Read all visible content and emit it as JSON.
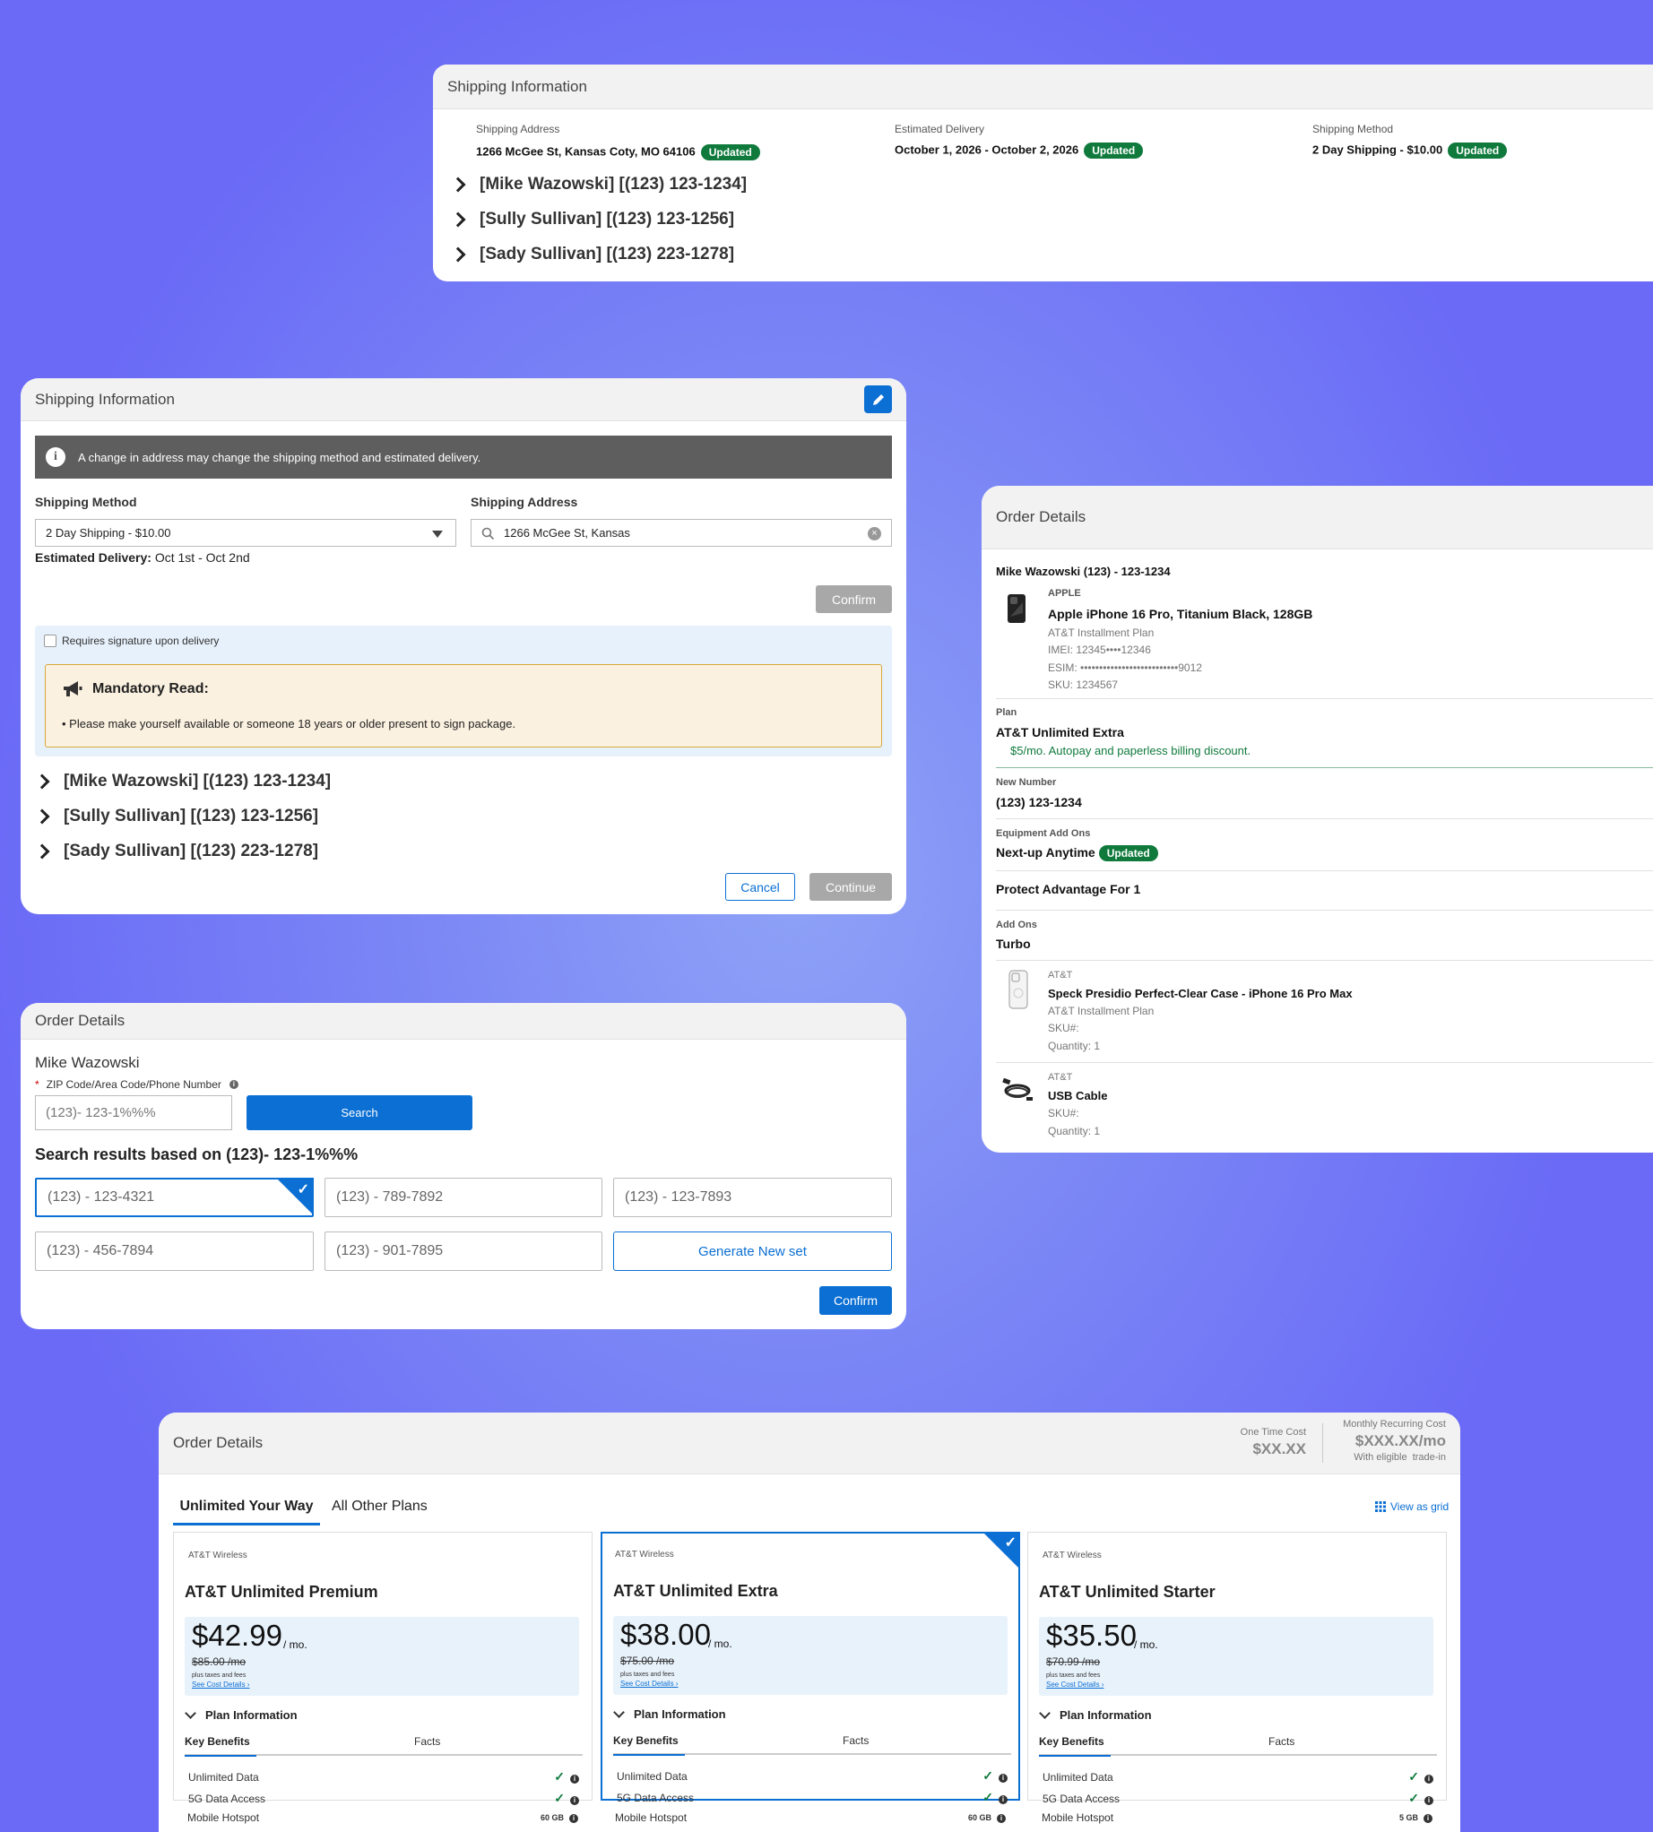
{
  "ship1": {
    "title": "Shipping Information",
    "address_label": "Shipping Address",
    "address_value": "1266 McGee St, Kansas Coty, MO 64106",
    "delivery_label": "Estimated Delivery",
    "delivery_value": "October 1, 2026 - October 2, 2026",
    "method_label": "Shipping Method",
    "method_value": "2 Day Shipping - $10.00",
    "updated": "Updated",
    "lines": [
      "[Mike Wazowski] [(123) 123-1234]",
      "[Sully Sullivan] [(123) 123-1256]",
      "[Sady Sullivan] [(123) 223-1278]"
    ]
  },
  "ship2": {
    "title": "Shipping Information",
    "notice": "A change in address may change the shipping method and estimated delivery.",
    "method_label": "Shipping Method",
    "method_value": "2 Day Shipping - $10.00",
    "address_label": "Shipping Address",
    "address_value": "1266 McGee St, Kansas",
    "est_label": "Estimated Delivery:",
    "est_value": " Oct 1st - Oct 2nd",
    "confirm": "Confirm",
    "signature": "Requires signature upon delivery",
    "mandatory_title": "Mandatory Read:",
    "mandatory_text": "Please make yourself available or someone 18 years or older present to sign package.",
    "lines": [
      "[Mike Wazowski] [(123) 123-1234]",
      "[Sully Sullivan] [(123) 123-1256]",
      "[Sady Sullivan] [(123) 223-1278]"
    ],
    "cancel": "Cancel",
    "continue": "Continue"
  },
  "order_right": {
    "title": "Order Details",
    "customer": "Mike Wazowski (123) - 123-1234",
    "device_brand": "APPLE",
    "device_name": "Apple iPhone 16 Pro, Titanium Black, 128GB",
    "device_plan": "AT&T Installment Plan",
    "imei": "IMEI: 12345••••12346",
    "esim": "ESIM: ••••••••••••••••••••••••••9012",
    "sku": "SKU: 1234567",
    "plan_label": "Plan",
    "plan_value": "AT&T Unlimited Extra",
    "plan_discount": "$5/mo. Autopay and paperless billing discount.",
    "number_label": "New Number",
    "number_value": "(123) 123-1234",
    "equip_label": "Equipment Add Ons",
    "equip_value": "Next-up Anytime",
    "updated": "Updated",
    "protect": "Protect Advantage For 1",
    "addons_label": "Add Ons",
    "addons_value": "Turbo",
    "acc1_brand": "AT&T",
    "acc1_name": "Speck Presidio Perfect-Clear Case - iPhone 16 Pro Max",
    "acc1_plan": "AT&T Installment Plan",
    "acc1_sku": "SKU#:",
    "acc1_qty": "Quantity: 1",
    "acc2_brand": "AT&T",
    "acc2_name": "USB Cable",
    "acc2_sku": "SKU#:",
    "acc2_qty": "Quantity: 1"
  },
  "order_left": {
    "title": "Order Details",
    "customer": "Mike Wazowski",
    "zip_label": "ZIP Code/Area Code/Phone Number",
    "zip_value": "(123)- 123-1%%%",
    "search": "Search",
    "results_title": "Search results based on (123)- 123-1%%%",
    "numbers": [
      "(123) - 123-4321",
      "(123) - 789-7892",
      "(123) - 123-7893",
      "(123) - 456-7894",
      "(123) - 901-7895"
    ],
    "generate": "Generate New set",
    "confirm": "Confirm"
  },
  "plans": {
    "title": "Order Details",
    "one_time_label": "One Time Cost",
    "one_time_value": "$XX.XX",
    "monthly_label": "Monthly Recurring Cost",
    "monthly_value": "$XXX.XX/mo",
    "monthly_note": "With eligible  trade-in",
    "tab_active": "Unlimited Your Way",
    "tab_other": "All Other Plans",
    "view_grid": "View as grid",
    "cards": [
      {
        "brand": "AT&T Wireless",
        "name": "AT&T Unlimited Premium",
        "price": "$42.99",
        "per": "/ mo.",
        "was": "$85.00 /mo",
        "tax": "plus taxes and fees",
        "cost": "See Cost Details ›",
        "info": "Plan Information",
        "tab1": "Key Benefits",
        "tab2": "Facts",
        "r1": "Unlimited Data",
        "r2": "5G Data Access",
        "r3": "Mobile Hotspot",
        "hotspot": "60 GB"
      },
      {
        "brand": "AT&T Wireless",
        "name": "AT&T Unlimited Extra",
        "price": "$38.00",
        "per": "/ mo.",
        "was": "$75.00 /mo",
        "tax": "plus taxes and fees",
        "cost": "See Cost Details ›",
        "info": "Plan Information",
        "tab1": "Key Benefits",
        "tab2": "Facts",
        "r1": "Unlimited Data",
        "r2": "5G Data Access",
        "r3": "Mobile Hotspot",
        "hotspot": "60 GB"
      },
      {
        "brand": "AT&T Wireless",
        "name": "AT&T Unlimited Starter",
        "price": "$35.50",
        "per": "/ mo.",
        "was": "$70.99 /mo",
        "tax": "plus taxes and fees",
        "cost": "See Cost Details ›",
        "info": "Plan Information",
        "tab1": "Key Benefits",
        "tab2": "Facts",
        "r1": "Unlimited Data",
        "r2": "5G Data Access",
        "r3": "Mobile Hotspot",
        "hotspot": "5 GB"
      }
    ]
  },
  "colors": {
    "accent": "#0b6fd3",
    "badge": "#0f7a3c",
    "background": "#7c88f5"
  },
  "icons": [
    "chevron-right-icon",
    "edit-pencil-icon",
    "info-icon",
    "caret-down-icon",
    "search-icon",
    "clear-icon",
    "megaphone-icon",
    "checkmark-icon",
    "grid-icon",
    "phone-image",
    "case-image",
    "cable-image"
  ]
}
